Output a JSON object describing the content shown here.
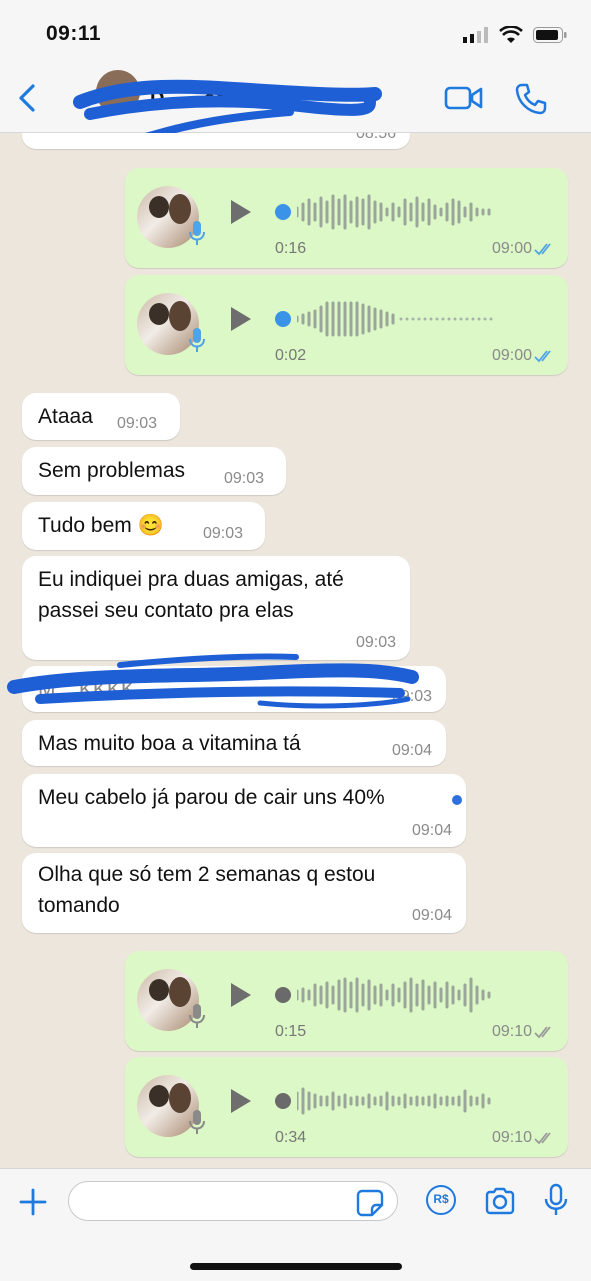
{
  "status_bar": {
    "time": "09:11"
  },
  "header": {
    "contact_name": "D... ...oda..."
  },
  "colors": {
    "accent": "#1f7ae0",
    "incoming_bubble": "#ffffff",
    "outgoing_bubble": "#dcf8c6",
    "read_ticks": "#4fa3e7",
    "delivered_ticks": "#9a9a9a",
    "redaction": "#1f5fd6"
  },
  "chat": {
    "prev_message_time": "08:56",
    "voice1": {
      "duration": "0:16",
      "time": "09:00"
    },
    "voice2": {
      "duration": "0:02",
      "time": "09:00"
    },
    "msg1": {
      "text": "Ataaa",
      "time": "09:03"
    },
    "msg2": {
      "text": "Sem problemas",
      "time": "09:03"
    },
    "msg3": {
      "text": "Tudo bem 😊",
      "time": "09:03"
    },
    "msg4": {
      "text": "Eu indiquei pra duas amigas, até passei seu contato pra elas",
      "time": "09:03"
    },
    "msg5": {
      "text": "M... KKKK",
      "time": "09:03"
    },
    "msg6": {
      "text": "Mas muito boa a vitamina tá",
      "time": "09:04"
    },
    "msg7": {
      "text": "Meu cabelo já parou de cair uns 40%",
      "time": "09:04"
    },
    "msg8": {
      "text": "Olha que só tem 2 semanas q estou tomando",
      "time": "09:04"
    },
    "voice3": {
      "duration": "0:15",
      "time": "09:10"
    },
    "voice4": {
      "duration": "0:34",
      "time": "09:10"
    }
  },
  "composer": {
    "placeholder": "",
    "pay_label": "R$"
  }
}
